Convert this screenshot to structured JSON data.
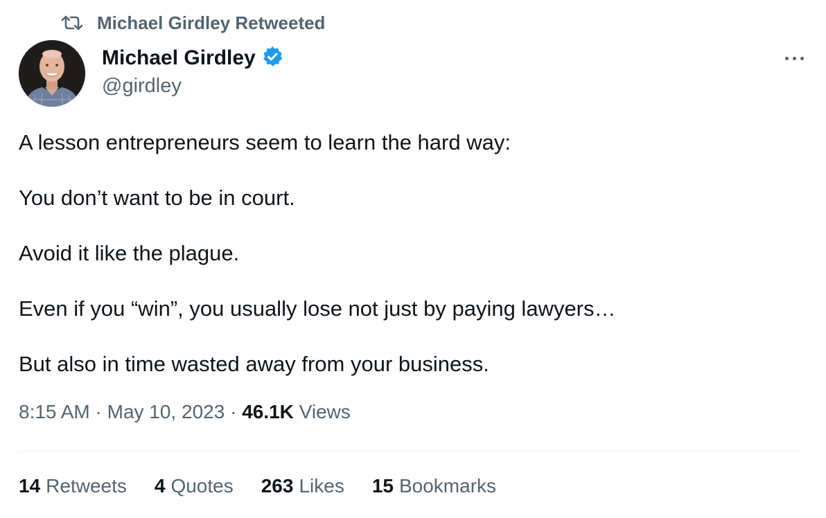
{
  "social_context": {
    "text": "Michael Girdley Retweeted",
    "icon": "retweet-icon"
  },
  "author": {
    "display_name": "Michael Girdley",
    "handle": "@girdley",
    "verified_icon": "verified-badge-icon",
    "verified_color": "#1d9bf0"
  },
  "more_icon": "more-options-icon",
  "tweet": {
    "paragraphs": [
      "A lesson entrepreneurs seem to learn the hard way:",
      "You don’t want to be in court.",
      "Avoid it like the plague.",
      "Even if you “win”, you usually lose not just by paying lawyers…",
      "But also in time wasted away from your business."
    ]
  },
  "meta": {
    "time": "8:15 AM",
    "separator": "·",
    "date": "May 10, 2023",
    "views_count": "46.1K",
    "views_label": "Views"
  },
  "stats": [
    {
      "count": "14",
      "label": "Retweets"
    },
    {
      "count": "4",
      "label": "Quotes"
    },
    {
      "count": "263",
      "label": "Likes"
    },
    {
      "count": "15",
      "label": "Bookmarks"
    }
  ],
  "colors": {
    "text_primary": "#0f1419",
    "text_secondary": "#536471",
    "divider": "#eff3f4",
    "accent": "#1d9bf0"
  }
}
